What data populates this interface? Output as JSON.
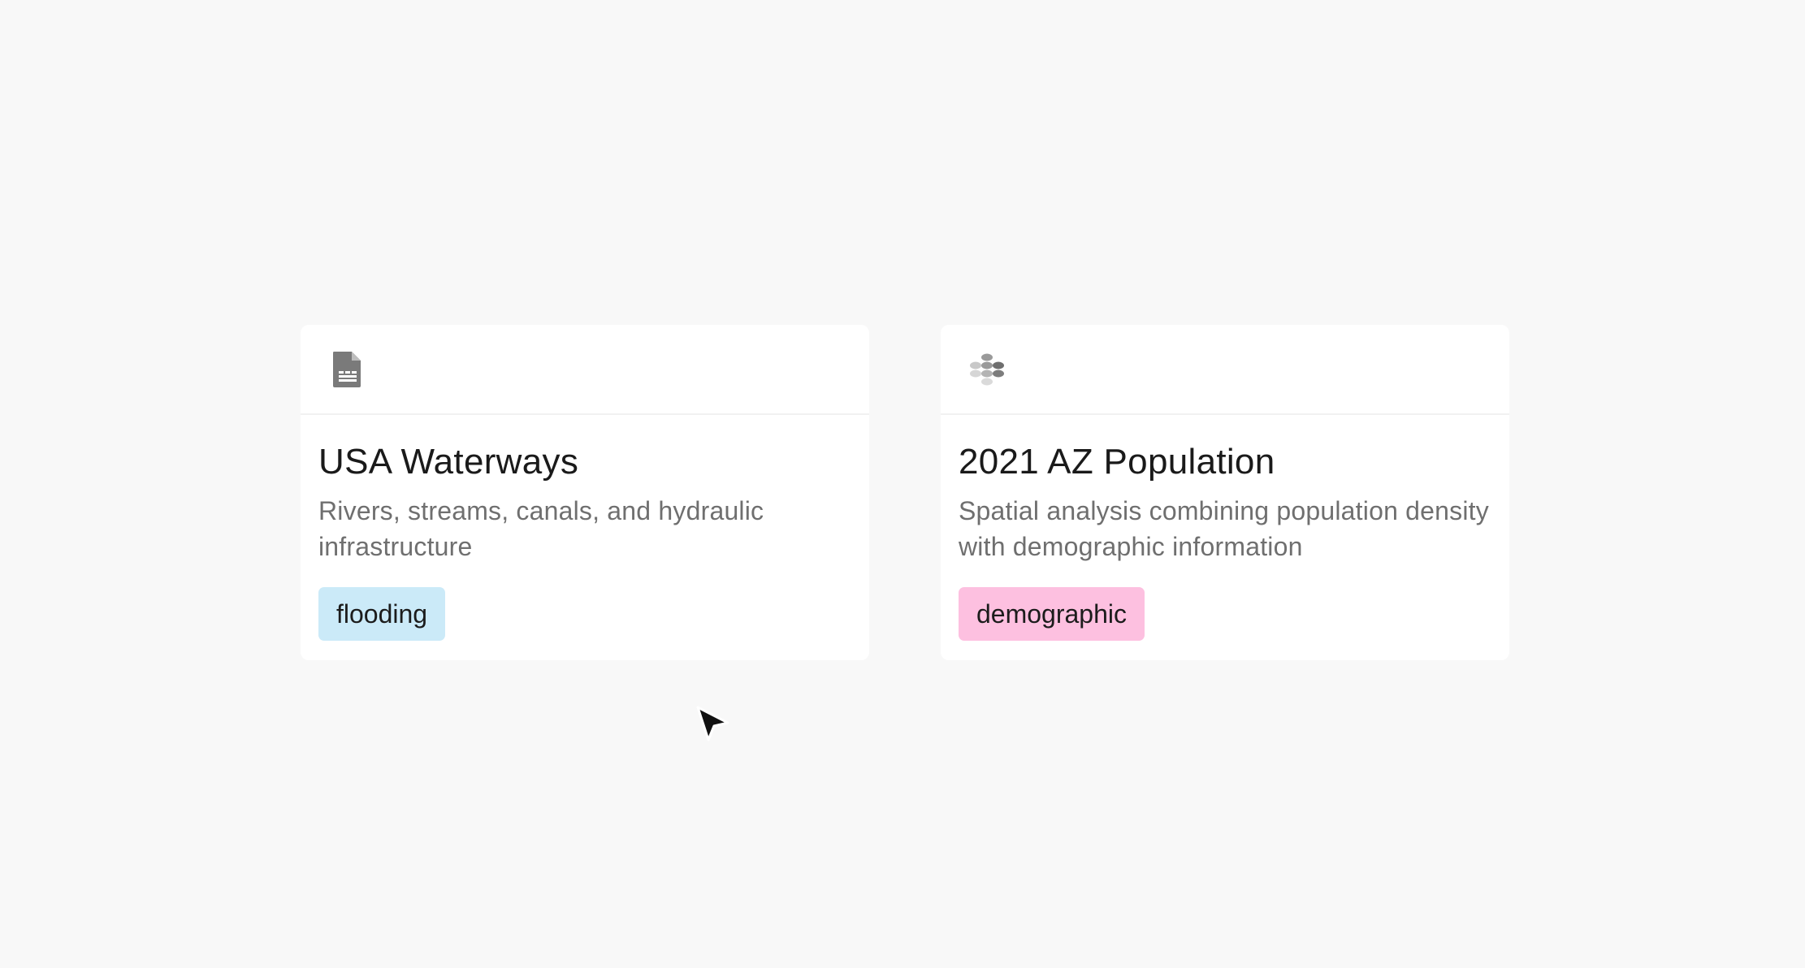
{
  "cards": [
    {
      "icon": "document-icon",
      "title": "USA Waterways",
      "description": "Rivers, streams, canals, and hydraulic infrastructure",
      "tag": {
        "label": "flooding",
        "color": "#cbeaf8"
      }
    },
    {
      "icon": "hexbin-icon",
      "title": "2021 AZ Population",
      "description": "Spatial analysis combining population density with demographic information",
      "tag": {
        "label": "demographic",
        "color": "#fdc0e0"
      }
    }
  ],
  "colors": {
    "background": "#f8f8f8",
    "card": "#ffffff",
    "title": "#1a1a1a",
    "description": "#6f6f6f",
    "icon": "#7a7a7a"
  },
  "cursor": {
    "icon": "mouse-pointer-icon"
  }
}
